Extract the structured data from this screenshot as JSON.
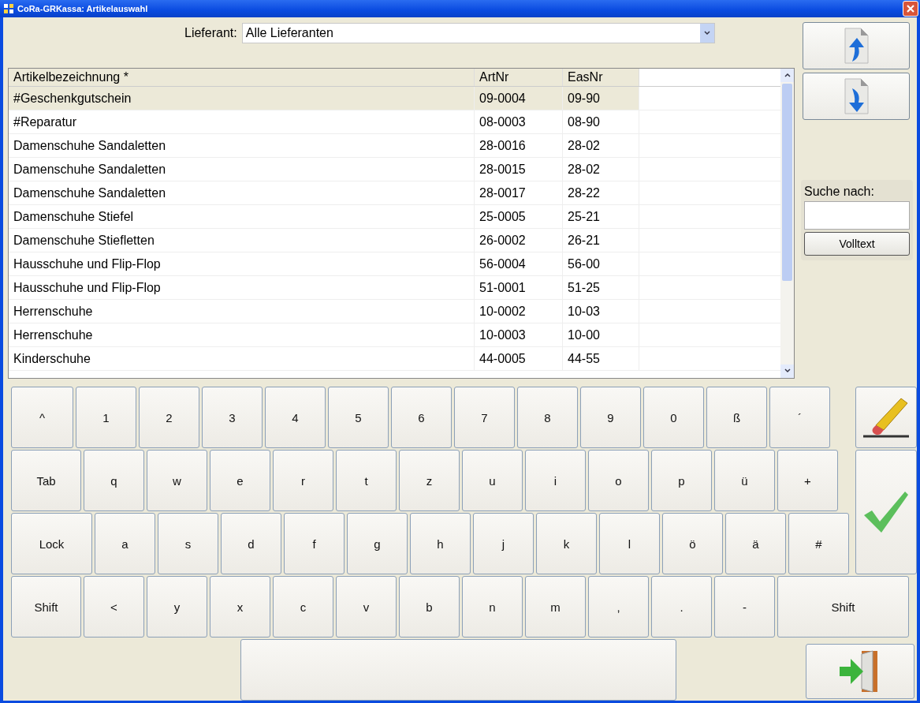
{
  "window": {
    "title": "CoRa-GRKassa: Artikelauswahl"
  },
  "supplier": {
    "label": "Lieferant:",
    "value": "Alle Lieferanten"
  },
  "table": {
    "columns": [
      "Artikelbezeichnung *",
      "ArtNr",
      "EasNr"
    ],
    "rows": [
      {
        "name": "#Geschenkgutschein",
        "artnr": "09-0004",
        "easnr": "09-90",
        "selected": true
      },
      {
        "name": "#Reparatur",
        "artnr": "08-0003",
        "easnr": "08-90",
        "selected": false
      },
      {
        "name": "Damenschuhe Sandaletten",
        "artnr": "28-0016",
        "easnr": "28-02",
        "selected": false
      },
      {
        "name": "Damenschuhe Sandaletten",
        "artnr": "28-0015",
        "easnr": "28-02",
        "selected": false
      },
      {
        "name": "Damenschuhe Sandaletten",
        "artnr": "28-0017",
        "easnr": "28-22",
        "selected": false
      },
      {
        "name": "Damenschuhe Stiefel",
        "artnr": "25-0005",
        "easnr": "25-21",
        "selected": false
      },
      {
        "name": "Damenschuhe Stiefletten",
        "artnr": "26-0002",
        "easnr": "26-21",
        "selected": false
      },
      {
        "name": "Hausschuhe und Flip-Flop",
        "artnr": "56-0004",
        "easnr": "56-00",
        "selected": false
      },
      {
        "name": "Hausschuhe und Flip-Flop",
        "artnr": "51-0001",
        "easnr": "51-25",
        "selected": false
      },
      {
        "name": "Herrenschuhe",
        "artnr": "10-0002",
        "easnr": "10-03",
        "selected": false
      },
      {
        "name": "Herrenschuhe",
        "artnr": "10-0003",
        "easnr": "10-00",
        "selected": false
      },
      {
        "name": "Kinderschuhe",
        "artnr": "44-0005",
        "easnr": "44-55",
        "selected": false
      }
    ]
  },
  "search": {
    "label": "Suche nach:",
    "button": "Volltext"
  },
  "keyboard": {
    "rows": [
      [
        {
          "kind": "first",
          "label": "^"
        },
        {
          "kind": "char",
          "label": "1"
        },
        {
          "kind": "char",
          "label": "2"
        },
        {
          "kind": "char",
          "label": "3"
        },
        {
          "kind": "char",
          "label": "4"
        },
        {
          "kind": "char",
          "label": "5"
        },
        {
          "kind": "char",
          "label": "6"
        },
        {
          "kind": "char",
          "label": "7"
        },
        {
          "kind": "char",
          "label": "8"
        },
        {
          "kind": "char",
          "label": "9"
        },
        {
          "kind": "char",
          "label": "0"
        },
        {
          "kind": "char",
          "label": "ß"
        },
        {
          "kind": "char",
          "label": "´"
        }
      ],
      [
        {
          "kind": "tab",
          "label": "Tab"
        },
        {
          "kind": "char",
          "label": "q"
        },
        {
          "kind": "char",
          "label": "w"
        },
        {
          "kind": "char",
          "label": "e"
        },
        {
          "kind": "char",
          "label": "r"
        },
        {
          "kind": "char",
          "label": "t"
        },
        {
          "kind": "char",
          "label": "z"
        },
        {
          "kind": "char",
          "label": "u"
        },
        {
          "kind": "char",
          "label": "i"
        },
        {
          "kind": "char",
          "label": "o"
        },
        {
          "kind": "char",
          "label": "p"
        },
        {
          "kind": "char",
          "label": "ü"
        },
        {
          "kind": "char",
          "label": "+"
        }
      ],
      [
        {
          "kind": "lock",
          "label": "Lock"
        },
        {
          "kind": "char",
          "label": "a"
        },
        {
          "kind": "char",
          "label": "s"
        },
        {
          "kind": "char",
          "label": "d"
        },
        {
          "kind": "char",
          "label": "f"
        },
        {
          "kind": "char",
          "label": "g"
        },
        {
          "kind": "char",
          "label": "h"
        },
        {
          "kind": "char",
          "label": "j"
        },
        {
          "kind": "char",
          "label": "k"
        },
        {
          "kind": "char",
          "label": "l"
        },
        {
          "kind": "char",
          "label": "ö"
        },
        {
          "kind": "char",
          "label": "ä"
        },
        {
          "kind": "char",
          "label": "#"
        }
      ],
      [
        {
          "kind": "tab",
          "label": "Shift"
        },
        {
          "kind": "char",
          "label": "<"
        },
        {
          "kind": "char",
          "label": "y"
        },
        {
          "kind": "char",
          "label": "x"
        },
        {
          "kind": "char",
          "label": "c"
        },
        {
          "kind": "char",
          "label": "v"
        },
        {
          "kind": "char",
          "label": "b"
        },
        {
          "kind": "char",
          "label": "n"
        },
        {
          "kind": "char",
          "label": "m"
        },
        {
          "kind": "char",
          "label": ","
        },
        {
          "kind": "char",
          "label": "."
        },
        {
          "kind": "char",
          "label": "-"
        },
        {
          "kind": "shift",
          "label": "Shift"
        }
      ]
    ]
  }
}
